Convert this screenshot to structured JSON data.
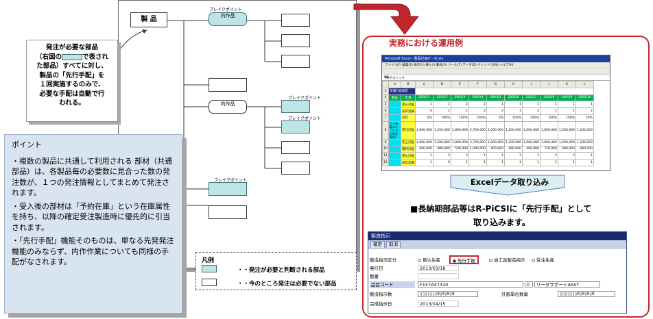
{
  "tree": {
    "product_label": "製 品",
    "breakpoint_label": "ブレイクポイント",
    "intermediate_label": "内作品"
  },
  "callout": {
    "line1": "発注が必要な部品",
    "line2a": "（右図の",
    "line2b": "で表され",
    "line3": "た部品）すべてに対し、",
    "line4": "製品の「先行手配」を",
    "line5": "１回実施するのみで、",
    "line6": "必要な手配は自動で行",
    "line7": "われる。"
  },
  "points": {
    "heading": "ポイント",
    "p1": "・複数の製品に共通して利用される 部材（共通部品）は、各製品毎の必要数に見合った数の発注数が、１つの発注情報としてまとめて発注されます。",
    "p2": "・受入後の部材は「予約在庫」という在庫属性を持ち、以降の確定受注製造時に優先的に引当されます。",
    "p3": "・「先行手配」機能そのものは、単なる先発発注機能のみならず、内作作業についても同様の手配がなされます。"
  },
  "legend": {
    "title": "凡例",
    "item1": "・・発注が必要と判断される部品",
    "item2": "・・今のところ発注は必要でない部品"
  },
  "right": {
    "title": "実務における運用例",
    "import_label": "Excelデータ取り込み",
    "note_line1": "■長納期部品等はR-PiCSIに「先行手配」として",
    "note_line2": "取り込みます。"
  },
  "excel": {
    "window_title": "Microsoft Excel - 製品計画(ﾃﾞｰﾀ).xls",
    "menu": "ファイル(F)  編集(E)  表示(V)  挿入(I)  書式(O)  ツール(T)  データ(D)  ウィンドウ(W)  ヘルプ(H)",
    "font": "MS Pゴシック",
    "cell_ref": "M5",
    "columns": [
      "A",
      "B",
      "C",
      "D",
      "E",
      "F",
      "G",
      "H",
      "I",
      "J",
      "K",
      "L"
    ],
    "header_cell": "年間計画策定",
    "year_header": "年月",
    "months": [
      "2005/1",
      "2005/2",
      "2005/3",
      "2005/4",
      "2005/5",
      "2005/6",
      "2005/7",
      "2005/8",
      "2005/9",
      "2005/10"
    ],
    "product_col": "製品",
    "group_label": "ＩＣ基板ﾕﾆｯﾄ（ﾊﾞｯｸ工程半導体）",
    "rows": [
      {
        "n": "5",
        "label": "受込計画",
        "vals": [
          "1",
          "1",
          "2",
          "2",
          "1",
          "1",
          "1",
          "1",
          "1",
          "1"
        ]
      },
      {
        "n": "6",
        "label": "前年実績",
        "vals": [
          "0",
          "1",
          "1",
          "2",
          "0",
          "1",
          "2",
          "1",
          "1",
          "2"
        ]
      },
      {
        "n": "7",
        "label": "対比",
        "vals": [
          "0%",
          "100%",
          "100%",
          "200%",
          "0%",
          "100%",
          "200%",
          "100%",
          "100%",
          "50%"
        ]
      },
      {
        "n": "8",
        "label": "受注計画",
        "vals": [
          "1,000,000",
          "1,200,000",
          "2,800,000",
          "2,700,000",
          "1,000,000",
          "1,200,000",
          "1,000,000",
          "1,000,000",
          "1,200,000",
          "1,200,000"
        ]
      },
      {
        "n": "9",
        "label": "売上計画",
        "vals": [
          "1,000,000",
          "1,200,000",
          "2,800,000",
          "2,700,000",
          "1,000,000",
          "1,200,000",
          "1,000,000",
          "1,000,000",
          "1,200,000",
          "1,200,000"
        ]
      },
      {
        "n": "10",
        "label": "粗利計画",
        "vals": [
          "400,000",
          "480,000",
          "500,000",
          "1,080,000",
          "400,000",
          "480,000",
          "400,000",
          "720,000",
          "480,000",
          "480,000"
        ]
      },
      {
        "n": "11",
        "label": "受込計画",
        "vals": [
          "1",
          "2",
          "2",
          "1",
          "1",
          "1",
          "1",
          "2",
          "2",
          "1"
        ]
      },
      {
        "n": "12",
        "label": "前年実績",
        "vals": [
          "1",
          "0",
          "1",
          "1",
          "1",
          "1",
          "1",
          "1",
          "1",
          "1"
        ]
      }
    ]
  },
  "form": {
    "title": "製造指示",
    "confirm": "確定",
    "cancel": "取消",
    "kind_label": "製造指示区分",
    "opt1": "見込生産",
    "opt2": "先行手配",
    "opt3": "治工具製造指示",
    "opt4": "受注生産",
    "issue_label": "発行日",
    "issue_value": "2013/03/18",
    "seq_label": "製番",
    "item_label": "品目コード",
    "item_value": "F157A47310",
    "item_zero": "0",
    "item_name": "リーダサポートASSY",
    "qty_label": "製造指示数",
    "unit_label": "計画単位数量",
    "due_label": "完成指示日",
    "due_value": "2013/04/15"
  }
}
